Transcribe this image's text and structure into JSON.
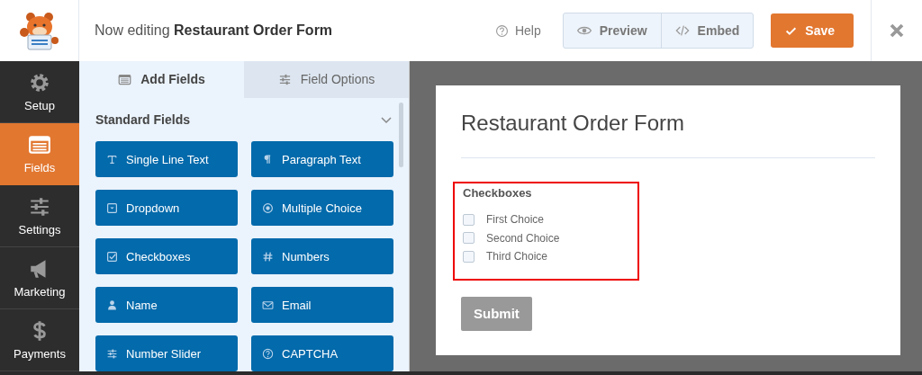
{
  "header": {
    "heading": "Now editing **Restaurant Order Form**",
    "help": "Help",
    "preview": "Preview",
    "embed": "Embed",
    "save": "Save"
  },
  "sidebar": {
    "items": [
      {
        "label": "Setup",
        "kind": "gear",
        "selected": false
      },
      {
        "label": "Fields",
        "kind": "form",
        "selected": true
      },
      {
        "label": "Settings",
        "kind": "sliders",
        "selected": false
      },
      {
        "label": "Marketing",
        "kind": "megaphone",
        "selected": false
      },
      {
        "label": "Payments",
        "kind": "dollar",
        "selected": false
      }
    ]
  },
  "panel": {
    "tabs": [
      {
        "label": "Add Fields",
        "kind": "form",
        "selected": true
      },
      {
        "label": "Field Options",
        "kind": "sliders",
        "selected": false
      }
    ],
    "section": {
      "title": "Standard Fields",
      "expanded": true
    },
    "fields": [
      {
        "label": "Single Line Text",
        "kind": "text"
      },
      {
        "label": "Paragraph Text",
        "kind": "pilcrow"
      },
      {
        "label": "Dropdown",
        "kind": "dropdown"
      },
      {
        "label": "Multiple Choice",
        "kind": "radio"
      },
      {
        "label": "Checkboxes",
        "kind": "checkbox"
      },
      {
        "label": "Numbers",
        "kind": "hash"
      },
      {
        "label": "Name",
        "kind": "person"
      },
      {
        "label": "Email",
        "kind": "envelope"
      },
      {
        "label": "Number Slider",
        "kind": "sliders"
      },
      {
        "label": "CAPTCHA",
        "kind": "question"
      }
    ]
  },
  "form": {
    "title": "Restaurant Order Form",
    "field": {
      "label": "Checkboxes",
      "highlighted": true,
      "choices": [
        {
          "label": "First Choice",
          "checked": false
        },
        {
          "label": "Second Choice",
          "checked": false
        },
        {
          "label": "Third Choice",
          "checked": false
        }
      ]
    },
    "submit": "Submit"
  }
}
